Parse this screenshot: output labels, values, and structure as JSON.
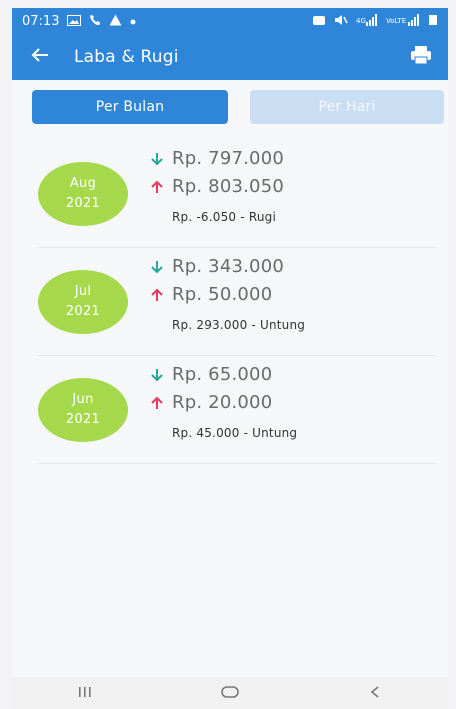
{
  "status_bar": {
    "time": "07:13",
    "signal_text": "VoLTE"
  },
  "app_bar": {
    "title": "Laba & Rugi"
  },
  "segments": [
    {
      "label": "Per Bulan",
      "selected": true
    },
    {
      "label": "Per Hari",
      "selected": false
    }
  ],
  "items": [
    {
      "month": "Aug",
      "year": "2021",
      "income": "Rp. 797.000",
      "expense": "Rp. 803.050",
      "summary": "Rp. -6.050 - Rugi"
    },
    {
      "month": "Jul",
      "year": "2021",
      "income": "Rp. 343.000",
      "expense": "Rp. 50.000",
      "summary": "Rp. 293.000 - Untung"
    },
    {
      "month": "Jun",
      "year": "2021",
      "income": "Rp. 65.000",
      "expense": "Rp. 20.000",
      "summary": "Rp. 45.000 - Untung"
    }
  ],
  "colors": {
    "primary": "#2f86d8",
    "badge": "#a6d84c",
    "income_arrow": "#26a69a",
    "expense_arrow": "#e53960"
  },
  "icons": {
    "back": "arrow-left-icon",
    "print": "printer-icon",
    "income": "arrow-down-icon",
    "expense": "arrow-up-icon",
    "nav_recent": "recent-apps-icon",
    "nav_home": "home-icon",
    "nav_back": "back-icon"
  }
}
